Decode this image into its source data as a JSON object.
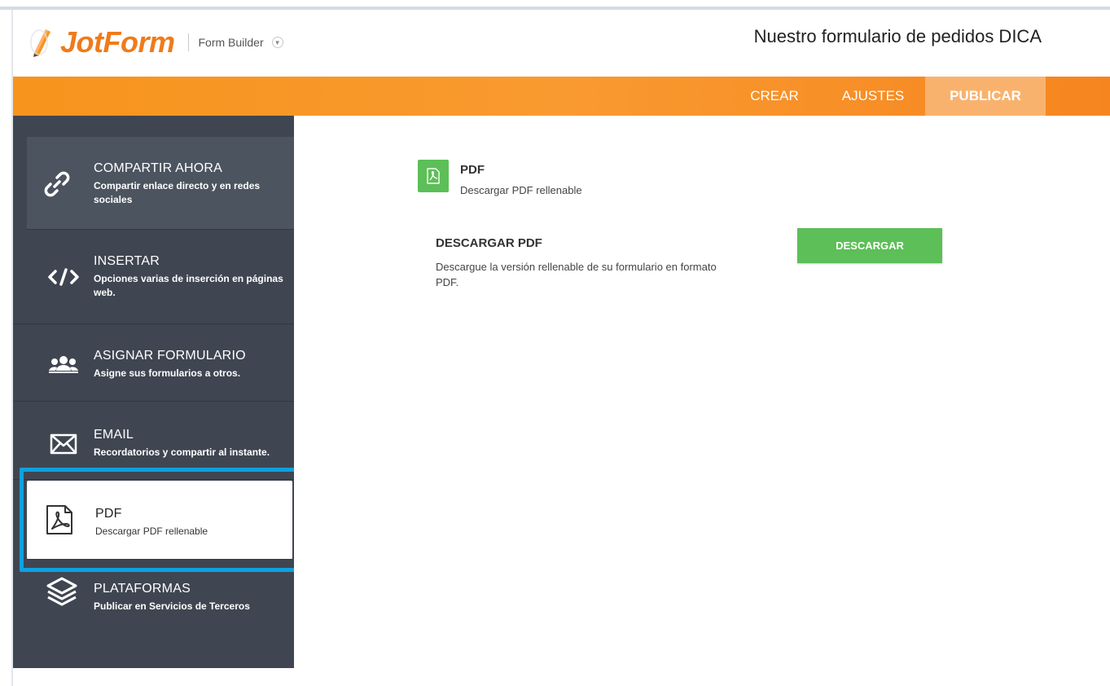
{
  "header": {
    "logo_text": "JotForm",
    "builder_label": "Form Builder",
    "form_title": "Nuestro formulario de pedidos DICA"
  },
  "nav": {
    "tabs": [
      {
        "label": "CREAR",
        "active": false
      },
      {
        "label": "AJUSTES",
        "active": false
      },
      {
        "label": "PUBLICAR",
        "active": true
      }
    ]
  },
  "sidebar": {
    "items": [
      {
        "icon": "link-icon",
        "title": "COMPARTIR AHORA",
        "subtitle": "Compartir enlace directo y en redes sociales"
      },
      {
        "icon": "code-icon",
        "title": "INSERTAR",
        "subtitle": "Opciones varias de inserción en páginas web."
      },
      {
        "icon": "users-icon",
        "title": "ASIGNAR FORMULARIO",
        "subtitle": "Asigne sus formularios a otros."
      },
      {
        "icon": "envelope-icon",
        "title": "EMAIL",
        "subtitle": "Recordatorios y compartir al instante."
      },
      {
        "icon": "pdf-icon",
        "title": "PDF",
        "subtitle": "Descargar PDF rellenable",
        "selected": true
      },
      {
        "icon": "layers-icon",
        "title": "PLATAFORMAS",
        "subtitle": "Publicar en Servicios de Terceros"
      }
    ]
  },
  "main": {
    "section_title": "PDF",
    "section_subtitle": "Descargar PDF rellenable",
    "download_title": "DESCARGAR PDF",
    "download_description": "Descargue la versión rellenable de su formulario en formato PDF.",
    "download_button": "DESCARGAR"
  },
  "colors": {
    "brand_orange": "#f7941d",
    "active_tab": "#f9b26d",
    "sidebar_bg": "#3f4651",
    "green": "#5cbf57",
    "highlight_blue": "#0ea1e0"
  }
}
